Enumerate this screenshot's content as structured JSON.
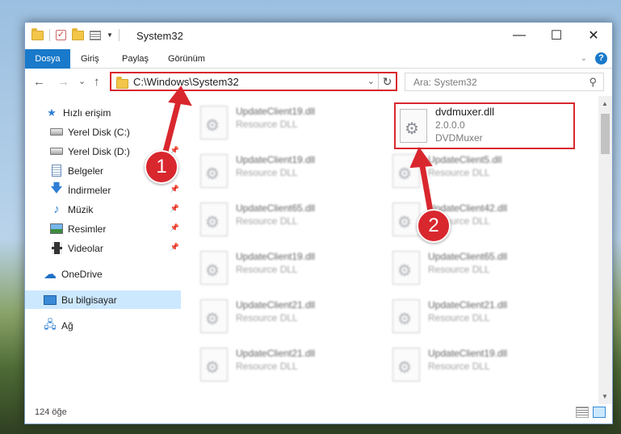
{
  "window": {
    "title": "System32",
    "controls": {
      "minimize": "—",
      "maximize": "☐",
      "close": "✕"
    }
  },
  "ribbon": {
    "tabs": [
      "Dosya",
      "Giriş",
      "Paylaş",
      "Görünüm"
    ],
    "help": "?"
  },
  "nav": {
    "back": "←",
    "forward": "→",
    "recent": "⌄",
    "up": "↑",
    "address": "C:\\Windows\\System32",
    "address_dropdown": "⌄",
    "refresh": "↻",
    "search_placeholder": "Ara: System32",
    "search_icon": "⚲"
  },
  "sidebar": {
    "items": [
      {
        "label": "Hızlı erişim",
        "icon": "star-icon"
      },
      {
        "label": "Yerel Disk (C:)",
        "icon": "drive-icon",
        "pinned": true
      },
      {
        "label": "Yerel Disk (D:)",
        "icon": "drive-icon",
        "pinned": true
      },
      {
        "label": "Belgeler",
        "icon": "documents-icon",
        "pinned": true
      },
      {
        "label": "İndirmeler",
        "icon": "download-icon",
        "pinned": true
      },
      {
        "label": "Müzik",
        "icon": "music-icon",
        "pinned": true
      },
      {
        "label": "Resimler",
        "icon": "pictures-icon",
        "pinned": true
      },
      {
        "label": "Videolar",
        "icon": "videos-icon",
        "pinned": true
      },
      {
        "label": "OneDrive",
        "icon": "cloud-icon"
      },
      {
        "label": "Bu bilgisayar",
        "icon": "computer-icon",
        "selected": true
      },
      {
        "label": "Ağ",
        "icon": "network-icon"
      }
    ]
  },
  "files": {
    "highlighted": {
      "name": "dvdmuxer.dll",
      "version": "2.0.0.0",
      "product": "DVDMuxer"
    },
    "left_column": [
      {
        "name": "UpdateClient19.dll",
        "type": "Resource DLL"
      },
      {
        "name": "UpdateClient19.dll",
        "type": "Resource DLL"
      },
      {
        "name": "UpdateClient65.dll",
        "type": "Resource DLL"
      },
      {
        "name": "UpdateClient19.dll",
        "type": "Resource DLL"
      },
      {
        "name": "UpdateClient21.dll",
        "type": "Resource DLL"
      },
      {
        "name": "UpdateClient21.dll",
        "type": "Resource DLL"
      }
    ],
    "right_column": [
      {
        "name": "UpdateClient5.dll",
        "type": "Resource DLL"
      },
      {
        "name": "UpdateClient42.dll",
        "type": "Resource DLL"
      },
      {
        "name": "UpdateClient65.dll",
        "type": "Resource DLL"
      },
      {
        "name": "UpdateClient21.dll",
        "type": "Resource DLL"
      },
      {
        "name": "UpdateClient19.dll",
        "type": "Resource DLL"
      }
    ]
  },
  "status": {
    "item_count": "124 öğe"
  },
  "annotations": {
    "step1": "1",
    "step2": "2",
    "color": "#d9272e"
  }
}
